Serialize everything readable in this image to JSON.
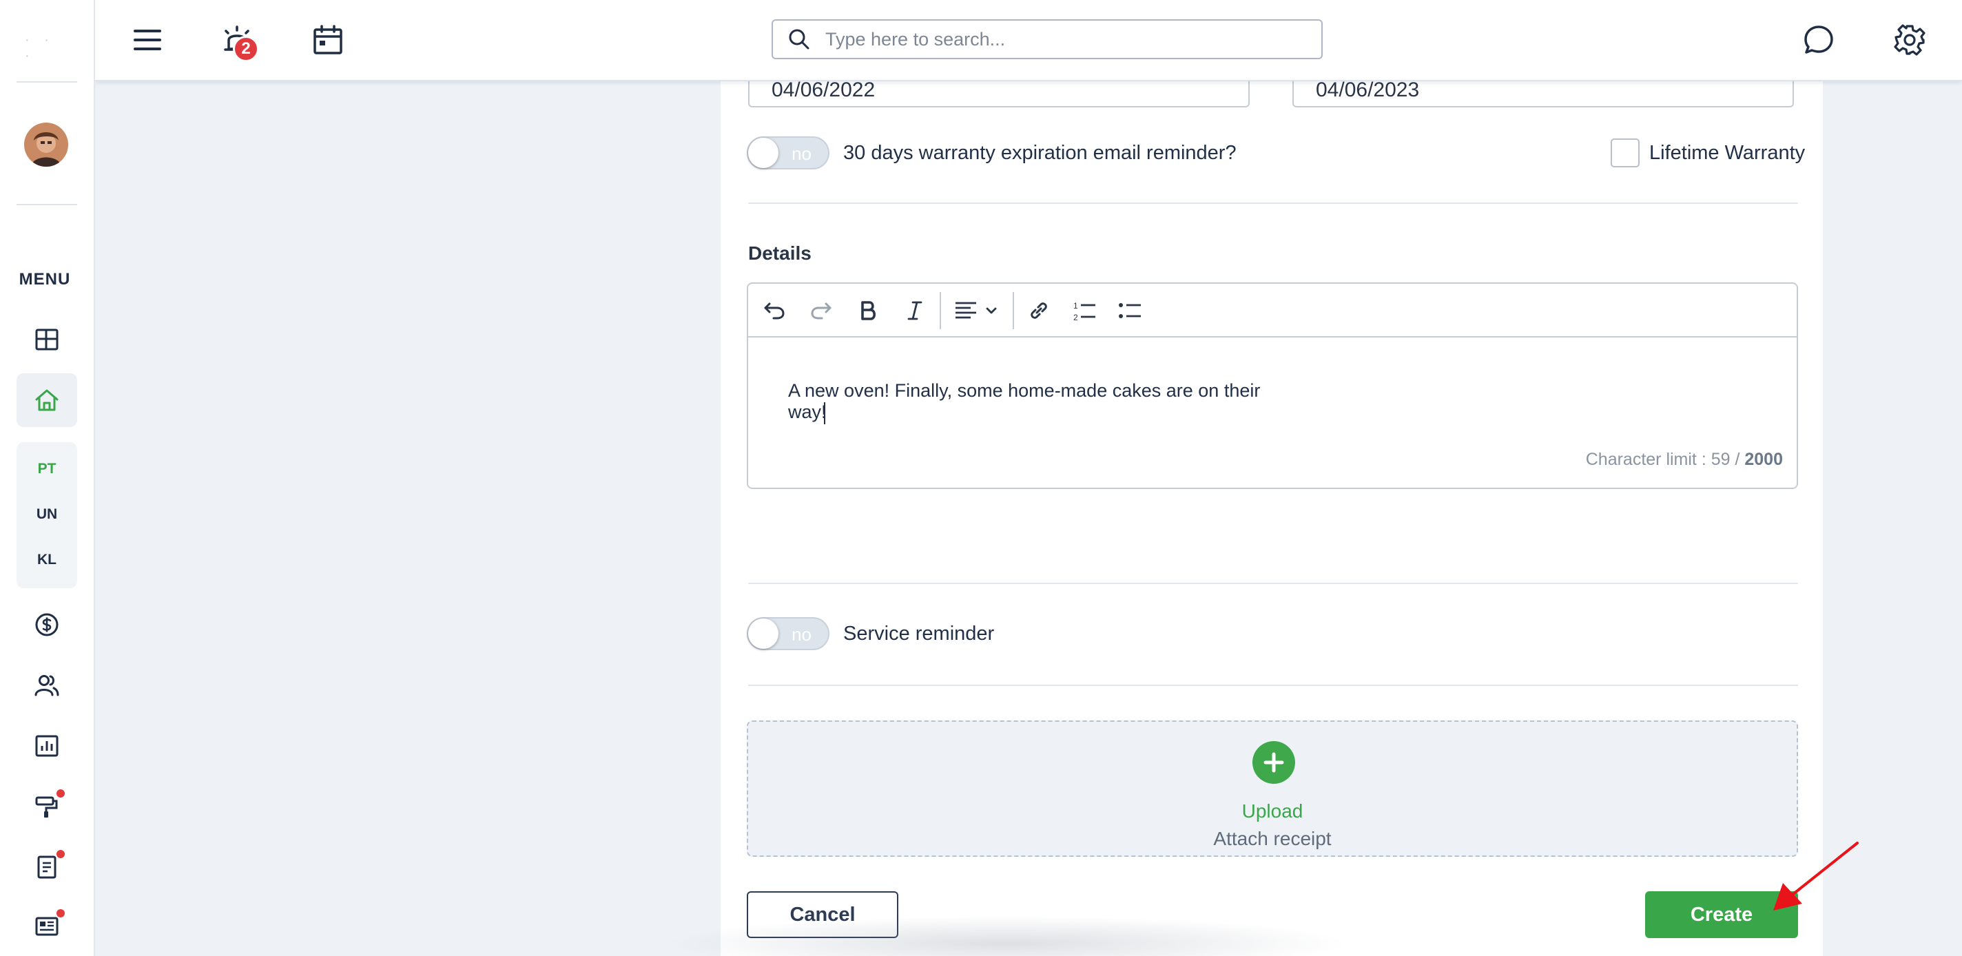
{
  "sidebar": {
    "menu_label": "MENU",
    "shortcuts": [
      "PT",
      "UN",
      "KL"
    ],
    "accent_color": "#3aa64a",
    "notification_dot_color": "#e23b3b"
  },
  "topbar": {
    "alerts_badge": "2",
    "search_placeholder": "Type here to search..."
  },
  "form": {
    "start_date": "04/06/2022",
    "end_date": "04/06/2023",
    "warranty_toggle": {
      "label": "no",
      "text": "30 days warranty expiration email reminder?"
    },
    "lifetime_warranty_label": "Lifetime Warranty",
    "details_title": "Details",
    "details_text": "A new oven! Finally, some home-made cakes are on their way!",
    "char_limit_prefix": "Character limit : 59 / ",
    "char_limit_max": "2000",
    "service_toggle": {
      "label": "no",
      "text": "Service reminder"
    },
    "upload": {
      "title": "Upload",
      "subtitle": "Attach receipt"
    },
    "cancel_label": "Cancel",
    "create_label": "Create"
  },
  "colors": {
    "primary_green": "#3aa64a",
    "badge_red": "#e0393e",
    "annotation_arrow": "#e8141a"
  }
}
